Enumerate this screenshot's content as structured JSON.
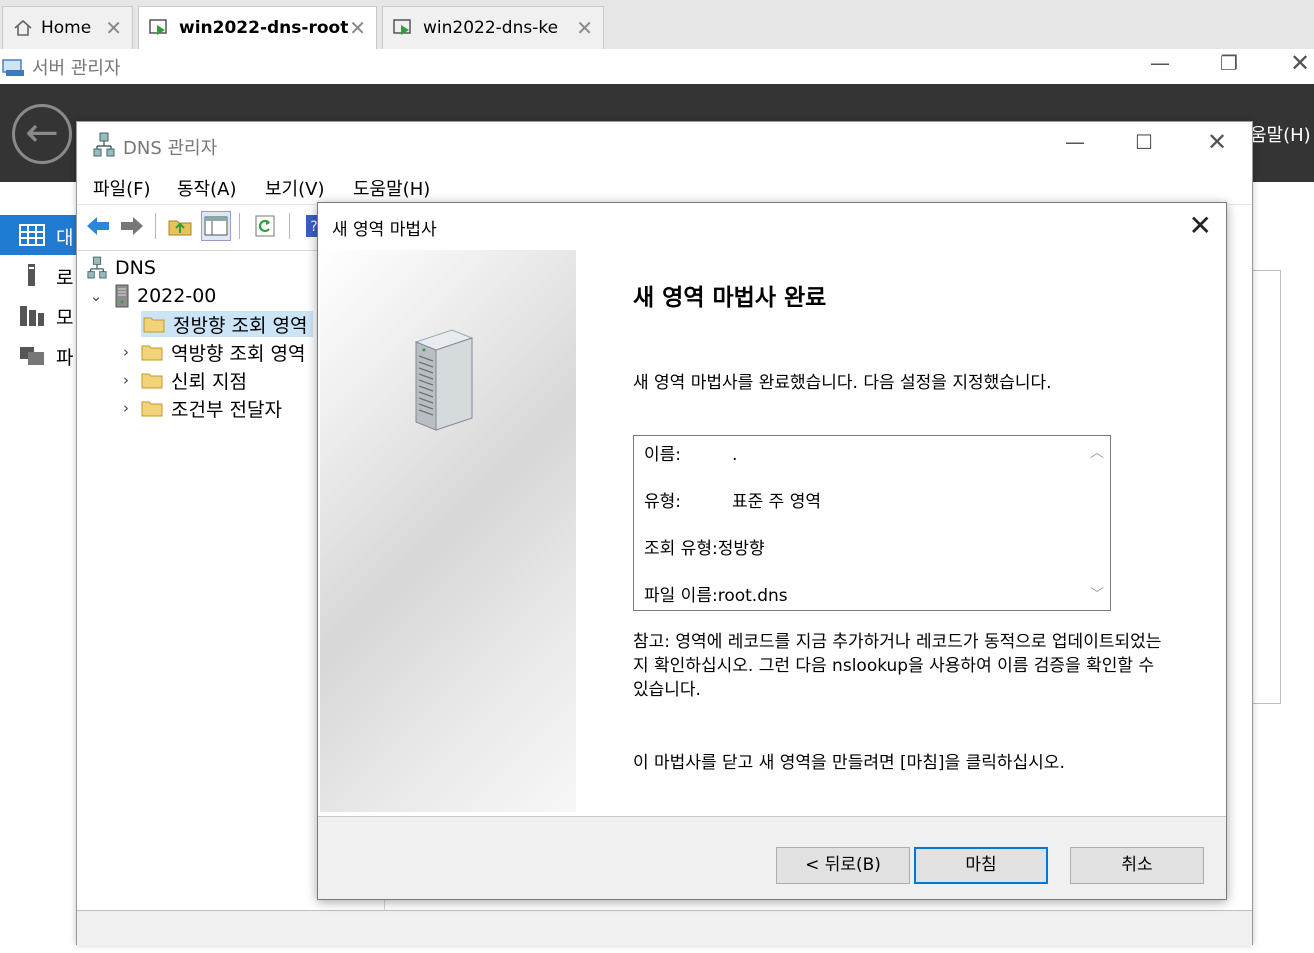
{
  "tabs": [
    {
      "label": "Home",
      "icon": "home-icon"
    },
    {
      "label": "win2022-dns-root",
      "icon": "vm-console-icon",
      "active": true
    },
    {
      "label": "win2022-dns-ke",
      "icon": "vm-console-icon"
    }
  ],
  "server_manager": {
    "title": "서버 관리자",
    "help_label": "움말(H)",
    "nav": [
      {
        "label": "대",
        "icon": "dashboard-icon",
        "active": true
      },
      {
        "label": "로",
        "icon": "local-server-icon"
      },
      {
        "label": "모",
        "icon": "all-servers-icon"
      },
      {
        "label": "파",
        "icon": "file-services-icon"
      }
    ]
  },
  "dns_manager": {
    "title": "DNS 관리자",
    "menu": [
      "파일(F)",
      "동작(A)",
      "보기(V)",
      "도움말(H)"
    ],
    "tree": {
      "root": "DNS",
      "server": "2022-00",
      "children": [
        "정방향 조회 영역",
        "역방향 조회 영역",
        "신뢰 지점",
        "조건부 전달자"
      ]
    }
  },
  "wizard": {
    "title": "새 영역 마법사",
    "heading": "새 영역 마법사 완료",
    "intro": "새 영역 마법사를 완료했습니다. 다음 설정을 지정했습니다.",
    "summary": [
      {
        "key": "이름:",
        "value": "."
      },
      {
        "key": "유형:",
        "value": "표준 주 영역"
      },
      {
        "key": "조회 유형:",
        "value": "정방향"
      },
      {
        "key": "파일 이름:",
        "value": "root.dns"
      }
    ],
    "note": "참고: 영역에 레코드를 지금 추가하거나 레코드가 동적으로 업데이트되었는지 확인하십시오. 그런 다음 nslookup을 사용하여 이름 검증을 확인할 수 있습니다.",
    "finish_hint": "이 마법사를 닫고 새 영역을 만들려면 [마침]을 클릭하십시오.",
    "buttons": {
      "back": "< 뒤로(B)",
      "finish": "마침",
      "cancel": "취소"
    }
  },
  "colors": {
    "accent": "#0078d7",
    "nav_active": "#1f7ad1",
    "header_dark": "#343434",
    "selection": "#cce4f7"
  }
}
